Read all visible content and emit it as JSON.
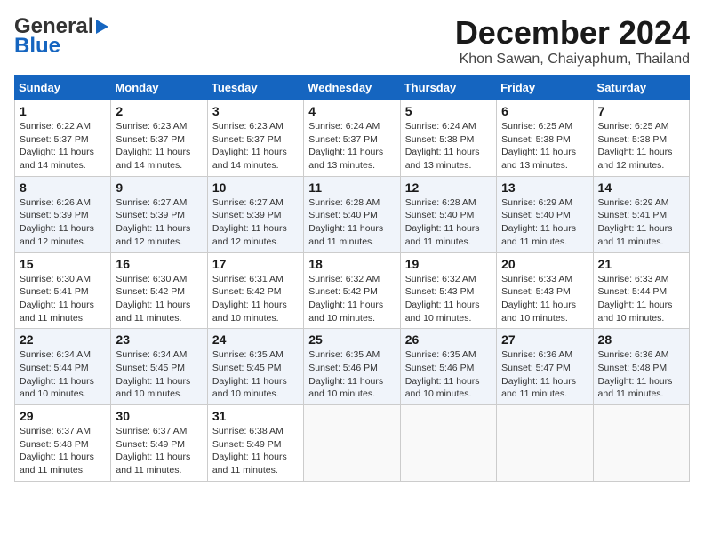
{
  "logo": {
    "part1": "General",
    "part2": "Blue"
  },
  "title": "December 2024",
  "location": "Khon Sawan, Chaiyaphum, Thailand",
  "days_of_week": [
    "Sunday",
    "Monday",
    "Tuesday",
    "Wednesday",
    "Thursday",
    "Friday",
    "Saturday"
  ],
  "weeks": [
    [
      {
        "day": "1",
        "info": "Sunrise: 6:22 AM\nSunset: 5:37 PM\nDaylight: 11 hours\nand 14 minutes."
      },
      {
        "day": "2",
        "info": "Sunrise: 6:23 AM\nSunset: 5:37 PM\nDaylight: 11 hours\nand 14 minutes."
      },
      {
        "day": "3",
        "info": "Sunrise: 6:23 AM\nSunset: 5:37 PM\nDaylight: 11 hours\nand 14 minutes."
      },
      {
        "day": "4",
        "info": "Sunrise: 6:24 AM\nSunset: 5:37 PM\nDaylight: 11 hours\nand 13 minutes."
      },
      {
        "day": "5",
        "info": "Sunrise: 6:24 AM\nSunset: 5:38 PM\nDaylight: 11 hours\nand 13 minutes."
      },
      {
        "day": "6",
        "info": "Sunrise: 6:25 AM\nSunset: 5:38 PM\nDaylight: 11 hours\nand 13 minutes."
      },
      {
        "day": "7",
        "info": "Sunrise: 6:25 AM\nSunset: 5:38 PM\nDaylight: 11 hours\nand 12 minutes."
      }
    ],
    [
      {
        "day": "8",
        "info": "Sunrise: 6:26 AM\nSunset: 5:39 PM\nDaylight: 11 hours\nand 12 minutes."
      },
      {
        "day": "9",
        "info": "Sunrise: 6:27 AM\nSunset: 5:39 PM\nDaylight: 11 hours\nand 12 minutes."
      },
      {
        "day": "10",
        "info": "Sunrise: 6:27 AM\nSunset: 5:39 PM\nDaylight: 11 hours\nand 12 minutes."
      },
      {
        "day": "11",
        "info": "Sunrise: 6:28 AM\nSunset: 5:40 PM\nDaylight: 11 hours\nand 11 minutes."
      },
      {
        "day": "12",
        "info": "Sunrise: 6:28 AM\nSunset: 5:40 PM\nDaylight: 11 hours\nand 11 minutes."
      },
      {
        "day": "13",
        "info": "Sunrise: 6:29 AM\nSunset: 5:40 PM\nDaylight: 11 hours\nand 11 minutes."
      },
      {
        "day": "14",
        "info": "Sunrise: 6:29 AM\nSunset: 5:41 PM\nDaylight: 11 hours\nand 11 minutes."
      }
    ],
    [
      {
        "day": "15",
        "info": "Sunrise: 6:30 AM\nSunset: 5:41 PM\nDaylight: 11 hours\nand 11 minutes."
      },
      {
        "day": "16",
        "info": "Sunrise: 6:30 AM\nSunset: 5:42 PM\nDaylight: 11 hours\nand 11 minutes."
      },
      {
        "day": "17",
        "info": "Sunrise: 6:31 AM\nSunset: 5:42 PM\nDaylight: 11 hours\nand 10 minutes."
      },
      {
        "day": "18",
        "info": "Sunrise: 6:32 AM\nSunset: 5:42 PM\nDaylight: 11 hours\nand 10 minutes."
      },
      {
        "day": "19",
        "info": "Sunrise: 6:32 AM\nSunset: 5:43 PM\nDaylight: 11 hours\nand 10 minutes."
      },
      {
        "day": "20",
        "info": "Sunrise: 6:33 AM\nSunset: 5:43 PM\nDaylight: 11 hours\nand 10 minutes."
      },
      {
        "day": "21",
        "info": "Sunrise: 6:33 AM\nSunset: 5:44 PM\nDaylight: 11 hours\nand 10 minutes."
      }
    ],
    [
      {
        "day": "22",
        "info": "Sunrise: 6:34 AM\nSunset: 5:44 PM\nDaylight: 11 hours\nand 10 minutes."
      },
      {
        "day": "23",
        "info": "Sunrise: 6:34 AM\nSunset: 5:45 PM\nDaylight: 11 hours\nand 10 minutes."
      },
      {
        "day": "24",
        "info": "Sunrise: 6:35 AM\nSunset: 5:45 PM\nDaylight: 11 hours\nand 10 minutes."
      },
      {
        "day": "25",
        "info": "Sunrise: 6:35 AM\nSunset: 5:46 PM\nDaylight: 11 hours\nand 10 minutes."
      },
      {
        "day": "26",
        "info": "Sunrise: 6:35 AM\nSunset: 5:46 PM\nDaylight: 11 hours\nand 10 minutes."
      },
      {
        "day": "27",
        "info": "Sunrise: 6:36 AM\nSunset: 5:47 PM\nDaylight: 11 hours\nand 11 minutes."
      },
      {
        "day": "28",
        "info": "Sunrise: 6:36 AM\nSunset: 5:48 PM\nDaylight: 11 hours\nand 11 minutes."
      }
    ],
    [
      {
        "day": "29",
        "info": "Sunrise: 6:37 AM\nSunset: 5:48 PM\nDaylight: 11 hours\nand 11 minutes."
      },
      {
        "day": "30",
        "info": "Sunrise: 6:37 AM\nSunset: 5:49 PM\nDaylight: 11 hours\nand 11 minutes."
      },
      {
        "day": "31",
        "info": "Sunrise: 6:38 AM\nSunset: 5:49 PM\nDaylight: 11 hours\nand 11 minutes."
      },
      {
        "day": "",
        "info": ""
      },
      {
        "day": "",
        "info": ""
      },
      {
        "day": "",
        "info": ""
      },
      {
        "day": "",
        "info": ""
      }
    ]
  ]
}
